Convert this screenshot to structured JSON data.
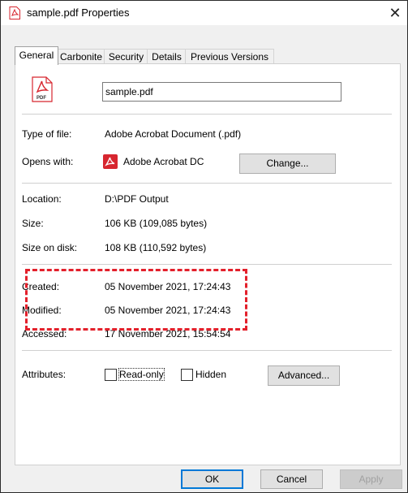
{
  "window": {
    "title": "sample.pdf Properties",
    "close_symbol": "✕"
  },
  "tabs": [
    {
      "label": "General",
      "active": true
    },
    {
      "label": "Carbonite"
    },
    {
      "label": "Security"
    },
    {
      "label": "Details"
    },
    {
      "label": "Previous Versions"
    }
  ],
  "general": {
    "file_icon_text": "PDF",
    "filename": "sample.pdf",
    "type_of_file": {
      "label": "Type of file:",
      "value": "Adobe Acrobat Document (.pdf)"
    },
    "opens_with": {
      "label": "Opens with:",
      "value": "Adobe Acrobat DC",
      "change_button": "Change..."
    },
    "location": {
      "label": "Location:",
      "value": "D:\\PDF Output"
    },
    "size": {
      "label": "Size:",
      "value": "106 KB (109,085 bytes)"
    },
    "size_on_disk": {
      "label": "Size on disk:",
      "value": "108 KB (110,592 bytes)"
    },
    "created": {
      "label": "Created:",
      "value": "05 November 2021, 17:24:43"
    },
    "modified": {
      "label": "Modified:",
      "value": "05 November 2021, 17:24:43"
    },
    "accessed": {
      "label": "Accessed:",
      "value": "17 November 2021, 15:54:54"
    },
    "attributes": {
      "label": "Attributes:",
      "read_only": {
        "label": "Read-only",
        "checked": false
      },
      "hidden": {
        "label": "Hidden",
        "checked": false
      },
      "advanced_button": "Advanced..."
    }
  },
  "footer": {
    "ok": "OK",
    "cancel": "Cancel",
    "apply": "Apply"
  },
  "colors": {
    "highlight_dashed_border": "#e3202b",
    "pdf_red": "#d7262f",
    "default_button_border": "#0078d7"
  },
  "icons": {
    "title": "pdf-file-icon",
    "file": "pdf-file-icon",
    "opens_with_app": "acrobat-icon",
    "close": "close-icon"
  }
}
